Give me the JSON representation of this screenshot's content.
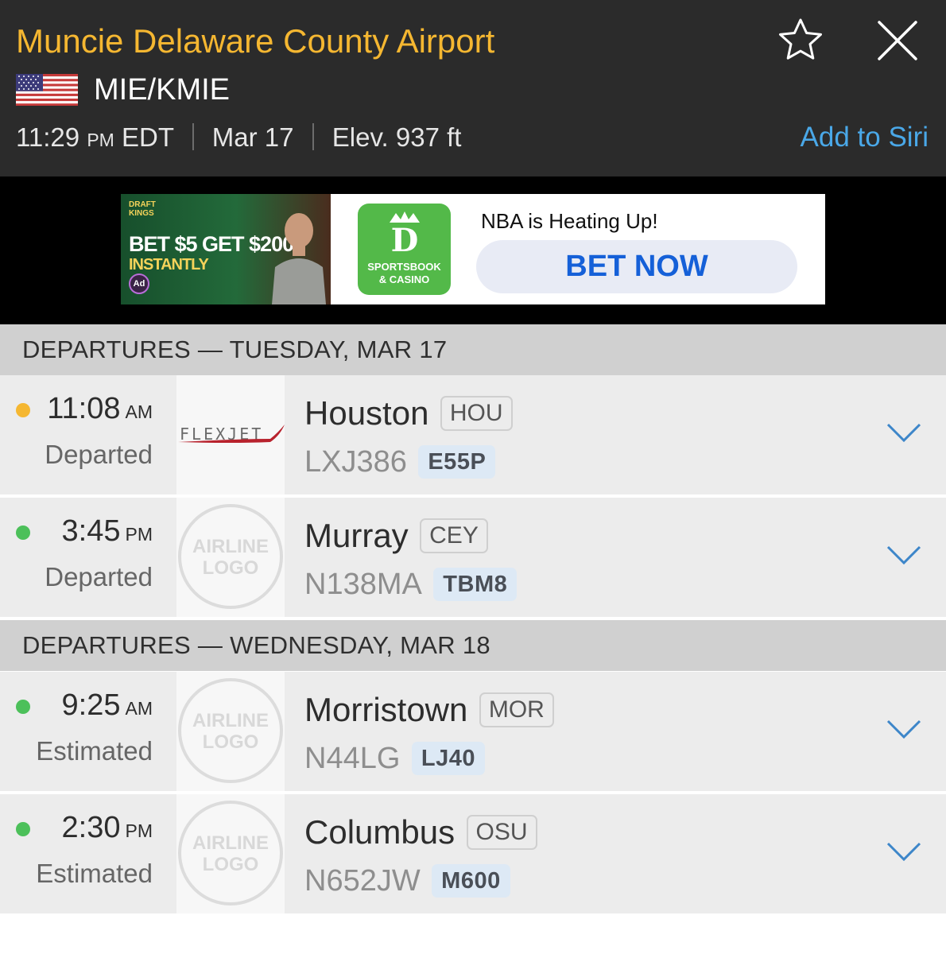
{
  "header": {
    "airport_name": "Muncie Delaware County Airport",
    "code": "MIE/KMIE",
    "time": "11:29",
    "ampm": "PM",
    "timezone": "EDT",
    "date": "Mar 17",
    "elevation": "Elev. 937 ft",
    "add_to_siri": "Add to Siri",
    "flag_icon": "us-flag-icon",
    "favorite_icon": "star-icon",
    "close_icon": "close-icon"
  },
  "ad": {
    "brand_line1": "DRAFT",
    "brand_line2": "KINGS",
    "promo": "BET $5 GET $200",
    "promo_sub": "INSTANTLY",
    "ad_badge": "Ad",
    "sportsbook_line1": "SPORTSBOOK",
    "sportsbook_line2": "& CASINO",
    "headline": "NBA is Heating Up!",
    "cta": "BET NOW"
  },
  "sections": [
    {
      "title": "DEPARTURES — TUESDAY, MAR 17",
      "flights": [
        {
          "time": "11:08",
          "ampm": "AM",
          "status": "Departed",
          "status_color": "#f5b731",
          "airline_logo": "FLEXJET",
          "destination": "Houston",
          "dest_code": "HOU",
          "flight": "LXJ386",
          "aircraft": "E55P"
        },
        {
          "time": "3:45",
          "ampm": "PM",
          "status": "Departed",
          "status_color": "#4cc05a",
          "airline_logo_line1": "AIRLINE",
          "airline_logo_line2": "LOGO",
          "destination": "Murray",
          "dest_code": "CEY",
          "flight": "N138MA",
          "aircraft": "TBM8"
        }
      ]
    },
    {
      "title": "DEPARTURES — WEDNESDAY, MAR 18",
      "flights": [
        {
          "time": "9:25",
          "ampm": "AM",
          "status": "Estimated",
          "status_color": "#4cc05a",
          "airline_logo_line1": "AIRLINE",
          "airline_logo_line2": "LOGO",
          "destination": "Morristown",
          "dest_code": "MOR",
          "flight": "N44LG",
          "aircraft": "LJ40"
        },
        {
          "time": "2:30",
          "ampm": "PM",
          "status": "Estimated",
          "status_color": "#4cc05a",
          "airline_logo_line1": "AIRLINE",
          "airline_logo_line2": "LOGO",
          "destination": "Columbus",
          "dest_code": "OSU",
          "flight": "N652JW",
          "aircraft": "M600"
        }
      ]
    }
  ],
  "colors": {
    "header_bg": "#2b2b2b",
    "airport_name": "#f5b731",
    "link": "#4aa8e8",
    "chevron": "#3d86c9"
  }
}
